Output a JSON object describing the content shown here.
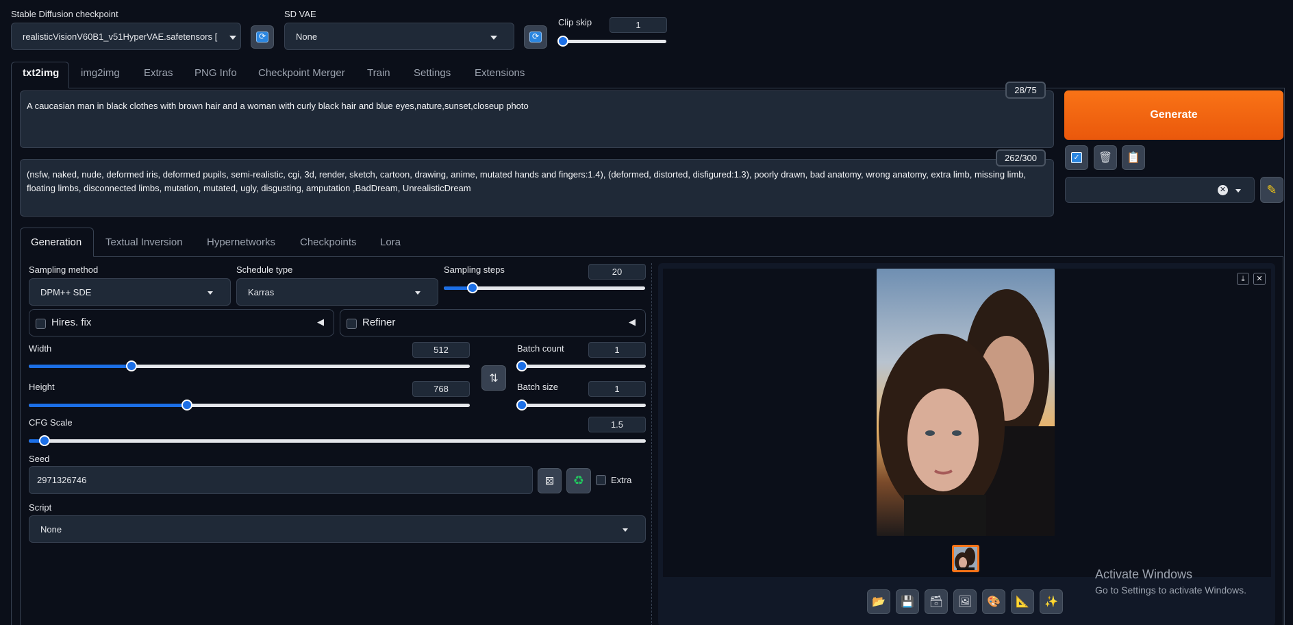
{
  "top": {
    "checkpoint_label": "Stable Diffusion checkpoint",
    "checkpoint_value": "realisticVisionV60B1_v51HyperVAE.safetensors [",
    "vae_label": "SD VAE",
    "vae_value": "None",
    "clip_skip_label": "Clip skip",
    "clip_skip_value": "1",
    "clip_skip_fraction": 0.0
  },
  "main_tabs": [
    "txt2img",
    "img2img",
    "Extras",
    "PNG Info",
    "Checkpoint Merger",
    "Train",
    "Settings",
    "Extensions"
  ],
  "prompt": {
    "positive": "A caucasian man in black clothes with brown hair  and a woman with curly black hair and blue eyes,nature,sunset,closeup photo",
    "positive_count": "28/75",
    "negative": "(nsfw, naked, nude, deformed iris, deformed pupils, semi-realistic, cgi, 3d, render, sketch, cartoon, drawing, anime, mutated hands and fingers:1.4), (deformed, distorted, disfigured:1.3), poorly drawn, bad anatomy, wrong anatomy, extra limb, missing limb, floating limbs, disconnected limbs, mutation, mutated, ugly, disgusting, amputation ,BadDream, UnrealisticDream",
    "negative_count": "262/300"
  },
  "generate_label": "Generate",
  "sub_tabs": [
    "Generation",
    "Textual Inversion",
    "Hypernetworks",
    "Checkpoints",
    "Lora"
  ],
  "generation": {
    "sampling_method_label": "Sampling method",
    "sampling_method_value": "DPM++ SDE",
    "schedule_type_label": "Schedule type",
    "schedule_type_value": "Karras",
    "sampling_steps_label": "Sampling steps",
    "sampling_steps_value": "20",
    "hires_label": "Hires. fix",
    "refiner_label": "Refiner",
    "width_label": "Width",
    "width_value": "512",
    "height_label": "Height",
    "height_value": "768",
    "batch_count_label": "Batch count",
    "batch_count_value": "1",
    "batch_size_label": "Batch size",
    "batch_size_value": "1",
    "cfg_label": "CFG Scale",
    "cfg_value": "1.5",
    "seed_label": "Seed",
    "seed_value": "2971326746",
    "extra_label": "Extra",
    "script_label": "Script",
    "script_value": "None"
  },
  "watermark": {
    "line1": "Activate Windows",
    "line2": "Go to Settings to activate Windows."
  },
  "colors": {
    "generate": "#ea580c",
    "accent": "#1c6fe6",
    "background": "#0b0f19"
  }
}
